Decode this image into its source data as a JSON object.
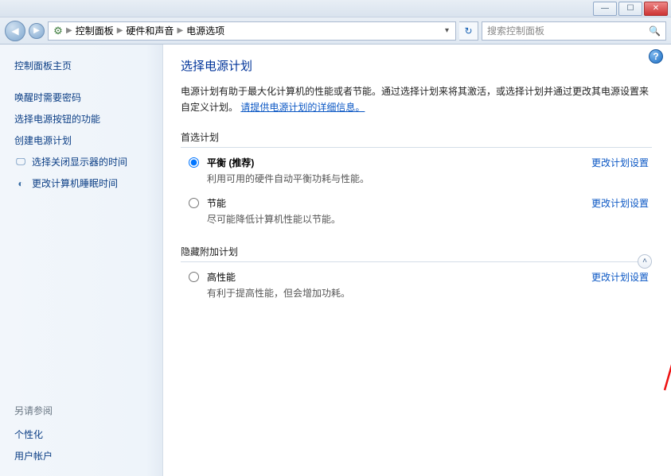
{
  "window": {
    "min": "—",
    "max": "☐",
    "close": "✕"
  },
  "nav": {
    "back": "◀",
    "fwd": "▶",
    "refresh": "↻"
  },
  "breadcrumb": {
    "root": "控制面板",
    "mid": "硬件和声音",
    "leaf": "电源选项",
    "sep": "▶",
    "dd": "▾"
  },
  "search": {
    "placeholder": "搜索控制面板",
    "icon": "🔍"
  },
  "sidebar": {
    "home": "控制面板主页",
    "links": [
      {
        "label": "唤醒时需要密码"
      },
      {
        "label": "选择电源按钮的功能"
      },
      {
        "label": "创建电源计划"
      },
      {
        "label": "选择关闭显示器的时间",
        "icon": "🖵"
      },
      {
        "label": "更改计算机睡眠时间",
        "icon": "◐"
      }
    ],
    "see_also_title": "另请参阅",
    "see_also": [
      {
        "label": "个性化"
      },
      {
        "label": "用户帐户"
      }
    ]
  },
  "main": {
    "help": "?",
    "title": "选择电源计划",
    "lead_a": "电源计划有助于最大化计算机的性能或者节能。通过选择计划来将其激活，或选择计划并通过更改其电源设置来自定义计划。",
    "lead_link": "请提供电源计划的详细信息。",
    "preferred_title": "首选计划",
    "hidden_title": "隐藏附加计划",
    "collapse": "˄",
    "change_link": "更改计划设置",
    "plans_preferred": [
      {
        "name": "平衡",
        "rec": " (推荐)",
        "desc": "利用可用的硬件自动平衡功耗与性能。",
        "checked": true
      },
      {
        "name": "节能",
        "rec": "",
        "desc": "尽可能降低计算机性能以节能。",
        "checked": false
      }
    ],
    "plans_hidden": [
      {
        "name": "高性能",
        "rec": "",
        "desc": "有利于提高性能，但会增加功耗。",
        "checked": false
      }
    ]
  }
}
